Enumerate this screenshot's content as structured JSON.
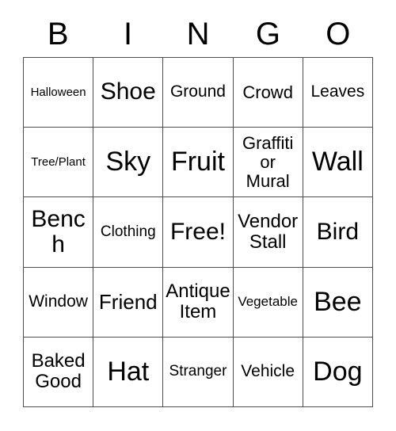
{
  "card": {
    "title": "BINGO",
    "header_letters": [
      "B",
      "I",
      "N",
      "G",
      "O"
    ],
    "grid_size": "5x5",
    "free_space": "Free!",
    "colors": {
      "text": "#000000",
      "border": "#4d4d4d",
      "background": "#ffffff"
    },
    "rows": [
      [
        {
          "label": "Halloween",
          "size": "xs",
          "marked": false
        },
        {
          "label": "Shoe",
          "size": "xxl",
          "marked": false
        },
        {
          "label": "Ground",
          "size": "m",
          "marked": false
        },
        {
          "label": "Crowd",
          "size": "ml",
          "marked": false
        },
        {
          "label": "Leaves",
          "size": "m",
          "marked": false
        }
      ],
      [
        {
          "label": "Tree/Plant",
          "size": "xs",
          "marked": false
        },
        {
          "label": "Sky",
          "size": "3xl",
          "marked": false
        },
        {
          "label": "Fruit",
          "size": "3xl",
          "marked": false
        },
        {
          "label": "Graffiti\nor\nMural",
          "size": "ml",
          "marked": false
        },
        {
          "label": "Wall",
          "size": "3xl",
          "marked": false
        }
      ],
      [
        {
          "label": "Bench",
          "size": "xxl",
          "marked": false
        },
        {
          "label": "Clothing",
          "size": "sm",
          "marked": false
        },
        {
          "label": "Free!",
          "size": "xxl",
          "marked": false
        },
        {
          "label": "Vendor\nStall",
          "size": "l",
          "marked": false
        },
        {
          "label": "Bird",
          "size": "xxl",
          "marked": false
        }
      ],
      [
        {
          "label": "Window",
          "size": "m",
          "marked": false
        },
        {
          "label": "Friend",
          "size": "xl",
          "marked": false
        },
        {
          "label": "Antique\nItem",
          "size": "l",
          "marked": false
        },
        {
          "label": "Vegetable",
          "size": "s",
          "marked": false
        },
        {
          "label": "Bee",
          "size": "3xl",
          "marked": false
        }
      ],
      [
        {
          "label": "Baked\nGood",
          "size": "l",
          "marked": false
        },
        {
          "label": "Hat",
          "size": "3xl",
          "marked": false
        },
        {
          "label": "Stranger",
          "size": "sm",
          "marked": false
        },
        {
          "label": "Vehicle",
          "size": "m",
          "marked": false
        },
        {
          "label": "Dog",
          "size": "3xl",
          "marked": false
        }
      ]
    ]
  }
}
